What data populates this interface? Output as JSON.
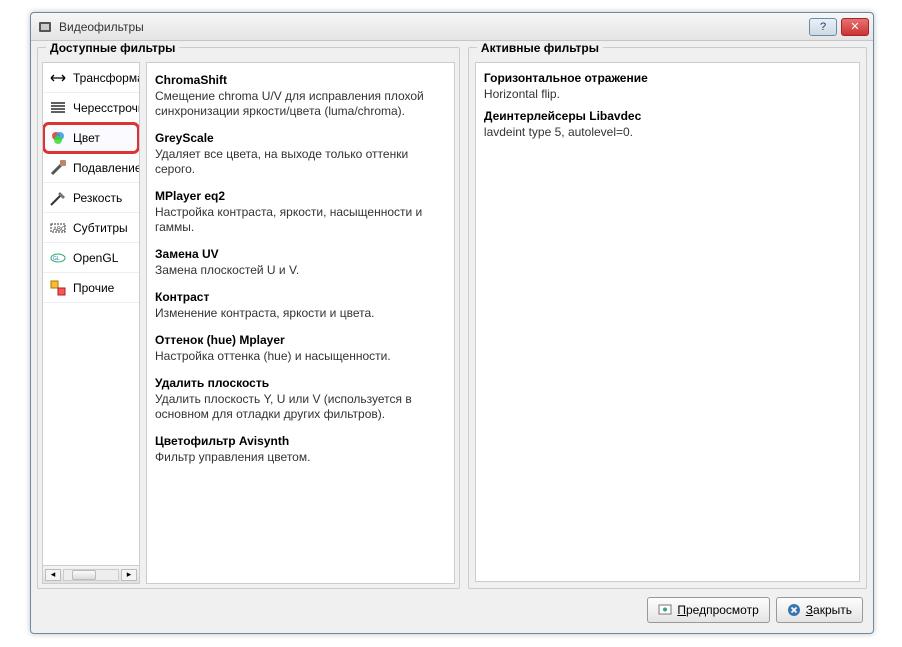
{
  "window": {
    "title": "Видеофильтры"
  },
  "groups": {
    "available": "Доступные фильтры",
    "active": "Активные фильтры"
  },
  "categories": [
    {
      "label": "Трансформация",
      "icon": "transform-icon"
    },
    {
      "label": "Чересстрочность",
      "icon": "interlace-icon"
    },
    {
      "label": "Цвет",
      "icon": "color-icon",
      "selected": true
    },
    {
      "label": "Подавление",
      "icon": "noise-icon"
    },
    {
      "label": "Резкость",
      "icon": "sharpness-icon"
    },
    {
      "label": "Субтитры",
      "icon": "subtitles-icon"
    },
    {
      "label": "OpenGL",
      "icon": "opengl-icon"
    },
    {
      "label": "Прочие",
      "icon": "misc-icon"
    }
  ],
  "filters": [
    {
      "name": "ChromaShift",
      "desc": "Смещение chroma U/V для исправления плохой синхронизации яркости/цвета (luma/chroma)."
    },
    {
      "name": "GreyScale",
      "desc": "Удаляет все цвета, на выходе только оттенки серого."
    },
    {
      "name": "MPlayer eq2",
      "desc": "Настройка контраста, яркости, насыщенности и гаммы."
    },
    {
      "name": "Замена UV",
      "desc": "Замена плоскостей U и V."
    },
    {
      "name": "Контраст",
      "desc": "Изменение контраста, яркости и цвета."
    },
    {
      "name": "Оттенок (hue) Mplayer",
      "desc": "Настройка оттенка (hue) и насыщенности."
    },
    {
      "name": "Удалить плоскость",
      "desc": "Удалить плоскость Y, U или V (используется в основном для отладки других фильтров)."
    },
    {
      "name": "Цветофильтр Avisynth",
      "desc": "Фильтр управления цветом."
    }
  ],
  "active_filters": [
    {
      "name": "Горизонтальное отражение",
      "desc": "Horizontal flip."
    },
    {
      "name": "Деинтерлейсеры Libavdec",
      "desc": "lavdeint type 5, autolevel=0."
    }
  ],
  "buttons": {
    "preview": "Предпросмотр",
    "close": "Закрыть",
    "preview_u": "П",
    "close_u": "З"
  }
}
